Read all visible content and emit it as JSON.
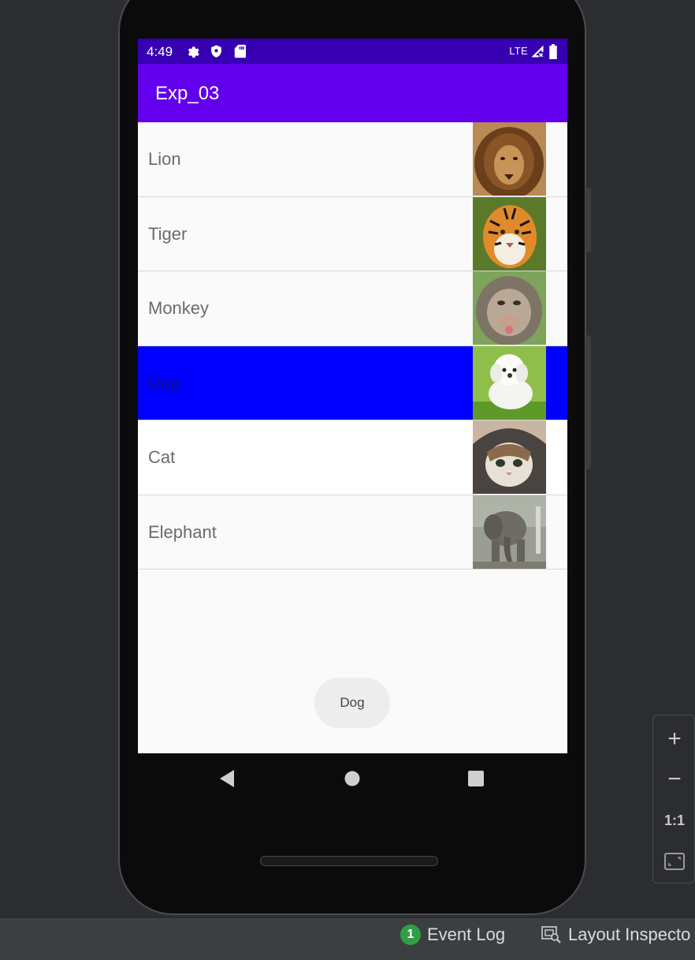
{
  "status_bar": {
    "time": "4:49",
    "network": "LTE"
  },
  "app_bar": {
    "title": "Exp_03"
  },
  "list": [
    {
      "label": "Lion",
      "image": "lion-photo"
    },
    {
      "label": "Tiger",
      "image": "tiger-photo"
    },
    {
      "label": "Monkey",
      "image": "monkey-photo"
    },
    {
      "label": "Dog",
      "image": "dog-photo",
      "selected": true
    },
    {
      "label": "Cat",
      "image": "cat-photo"
    },
    {
      "label": "Elephant",
      "image": "elephant-photo"
    }
  ],
  "toast": {
    "text": "Dog"
  },
  "zoom_controls": {
    "zoom_in": "+",
    "zoom_out": "−",
    "actual_size": "1:1"
  },
  "bottom_bar": {
    "event_log_count": "1",
    "event_log_label": "Event Log",
    "layout_inspector_label": "Layout Inspecto"
  },
  "colors": {
    "status_bar": "#3700b3",
    "app_bar": "#6200ee",
    "selected_row": "#0000ff"
  }
}
